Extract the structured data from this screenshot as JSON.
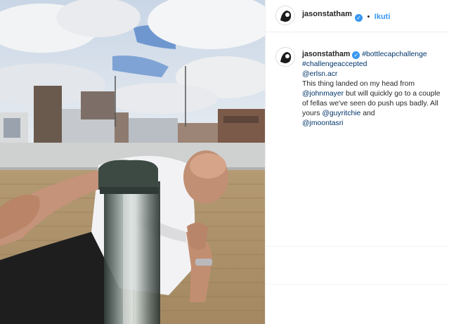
{
  "post": {
    "username": "jasonstatham",
    "follow_label": "Ikuti",
    "separator": "•"
  },
  "caption": {
    "username": "jasonstatham",
    "hashtag1": "#bottlecapchallenge",
    "hashtag2": "#challengeaccepted",
    "mention1": "@erlsn.acr",
    "text1": "This thing landed on my head from",
    "mention2": "@johnmayer",
    "text2": "but will quickly go to a couple of fellas we've seen do push ups badly. All yours",
    "mention3": "@guyritchie",
    "text3": "and",
    "mention4": "@jmoontasri"
  },
  "colors": {
    "link_blue": "#3897f0",
    "tag_navy": "#003569",
    "text": "#262626"
  }
}
